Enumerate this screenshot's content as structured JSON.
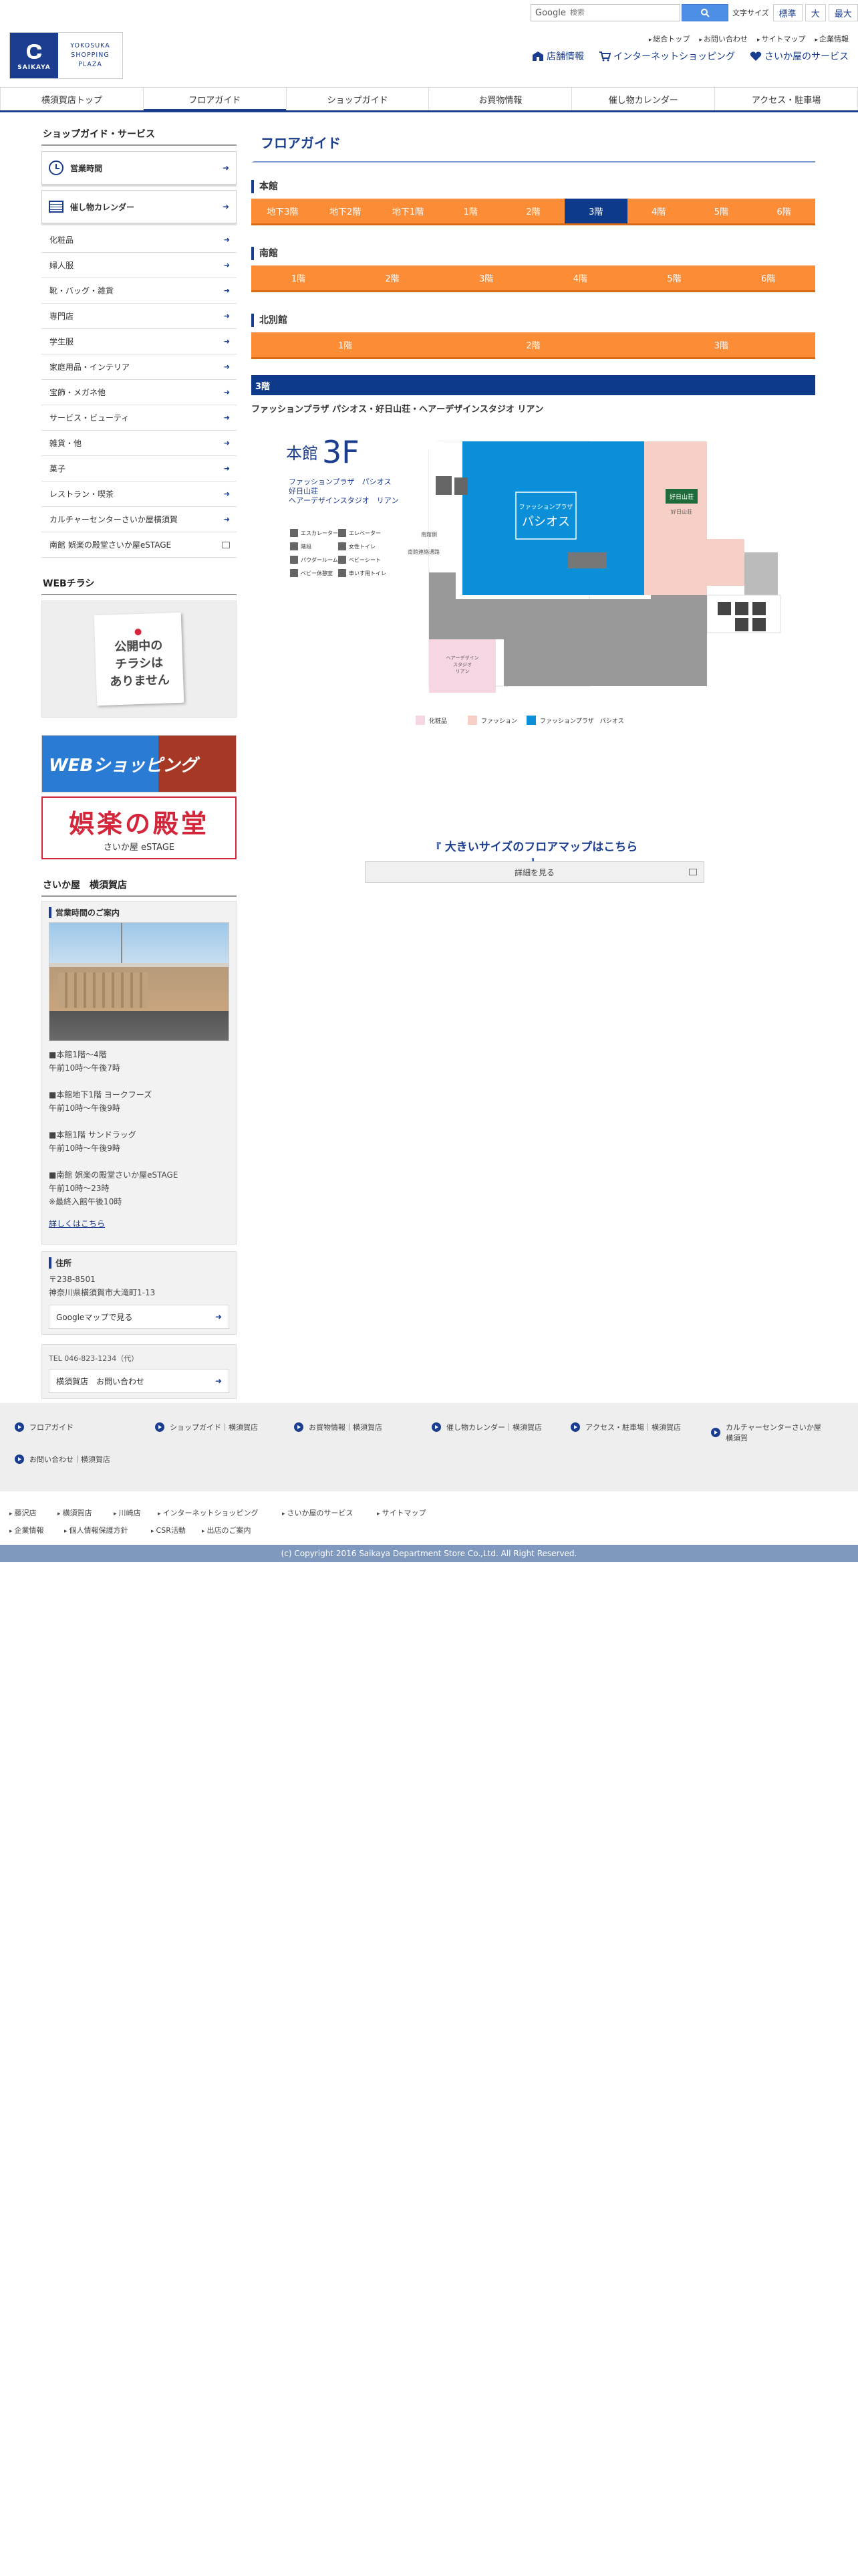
{
  "header": {
    "logo_mark": "SAIKAYA",
    "logo_line1": "YOKOSUKA",
    "logo_line2": "SHOPPING",
    "logo_line3": "PLAZA",
    "search_brand": "Google",
    "search_placeholder": "検索",
    "font_size_label": "文字サイズ",
    "font_sizes": [
      "標準",
      "大",
      "最大"
    ],
    "util_links": [
      "総合トップ",
      "お問い合わせ",
      "サイトマップ",
      "企業情報"
    ],
    "links": [
      "店舗情報",
      "インターネットショッピング",
      "さいか屋のサービス"
    ]
  },
  "gnav": [
    "横須賀店トップ",
    "フロアガイド",
    "ショップガイド",
    "お買物情報",
    "催し物カレンダー",
    "アクセス・駐車場"
  ],
  "sidebar": {
    "title": "ショップガイド・サービス",
    "hours_label": "営業時間",
    "calendar_label": "催し物カレンダー",
    "items": [
      "化粧品",
      "婦人服",
      "靴・バッグ・雑貨",
      "専門店",
      "学生服",
      "家庭用品・インテリア",
      "宝飾・メガネ他",
      "サービス・ビューティ",
      "雑貨・他",
      "菓子",
      "レストラン・喫茶",
      "カルチャーセンターさいか屋横須賀",
      "南館 娯楽の殿堂さいか屋eSTAGE"
    ],
    "flyer_title": "WEBチラシ",
    "flyer_text": [
      "公開中の",
      "チラシは",
      "ありません"
    ],
    "banner_web": "WEBショッピング",
    "banner_estage": "娯楽の殿堂",
    "banner_estage_sub": "さいか屋 eSTAGE",
    "store_title": "さいか屋　横須賀店",
    "hours_heading": "営業時間のご案内",
    "hours_text": "■本館1階～4階\n午前10時～午後7時\n\n■本館地下1階 ヨークフーズ\n午前10時～午後9時\n\n■本館1階 サンドラッグ\n午前10時～午後9時\n\n■南館 娯楽の殿堂さいか屋eSTAGE\n午前10時～23時\n※最終入館午後10時",
    "more_link": "詳しくはこちら",
    "address_heading": "住所",
    "address_text": "〒238-8501\n神奈川県横須賀市大滝町1-13",
    "map_link": "Googleマップで見る",
    "tel": "TEL 046-823-1234（代）",
    "contact_link": "横須賀店　お問い合わせ"
  },
  "main": {
    "title": "フロアガイド",
    "honkan_label": "本館",
    "honkan_floors": [
      "地下3階",
      "地下2階",
      "地下1階",
      "1階",
      "2階",
      "3階",
      "4階",
      "5階",
      "6階"
    ],
    "honkan_current": "3階",
    "minami_label": "南館",
    "minami_floors": [
      "1階",
      "2階",
      "3階",
      "4階",
      "5階",
      "6階"
    ],
    "kita_label": "北別館",
    "kita_floors": [
      "1階",
      "2階",
      "3階"
    ],
    "floor_bar": "3階",
    "floor_subtitle": "ファッションプラザ パシオス・好日山荘・ヘアーデザインスタジオ リアン",
    "map": {
      "building": "本館",
      "floor": "3F",
      "lines": [
        "ファッションプラザ　パシオス",
        "好日山荘",
        "ヘアーデザインスタジオ　リアン"
      ],
      "icons": [
        "エスカレーター",
        "エレベーター",
        "階段",
        "女性トイレ",
        "パウダールーム",
        "ベビーシート",
        "ベビー休憩室",
        "車いす用トイレ"
      ],
      "pasios_small": "ファッションプラザ",
      "pasios_big": "パシオス",
      "kojitsu_logo": "好日山荘",
      "kojitsu_label": "好日山荘",
      "rian_label": "ヘアーデザイン\nスタジオ\nリアン",
      "to_south": "南館連絡通路",
      "side_text": "南館側",
      "legend": [
        "化粧品",
        "ファッション",
        "ファッションプラザ　パシオス"
      ]
    },
    "bigmap_link": "大きいサイズのフロアマップはこちら",
    "detail_button": "詳細を見る"
  },
  "footer": {
    "links": [
      "フロアガイド",
      "ショップガイド｜横須賀店",
      "お買物情報｜横須賀店",
      "催し物カレンダー｜横須賀店",
      "アクセス・駐車場｜横須賀店",
      "カルチャーセンターさいか屋横須賀",
      "お問い合わせ｜横須賀店"
    ],
    "sub_links": [
      "藤沢店",
      "横須賀店",
      "川崎店",
      "インターネットショッピング",
      "さいか屋のサービス",
      "サイトマップ",
      "企業情報",
      "個人情報保護方針",
      "CSR活動",
      "出店のご案内"
    ],
    "copyright": "(c) Copyright 2016 Saikaya Department Store Co.,Ltd. All Right Reserved."
  },
  "colors": {
    "brand": "#1a3d8f",
    "orange": "#fd8c37",
    "current": "#0e3a8b",
    "pasios": "#0b8fd9",
    "fashion": "#f6cfc6",
    "cosme": "#f7d6e3"
  }
}
